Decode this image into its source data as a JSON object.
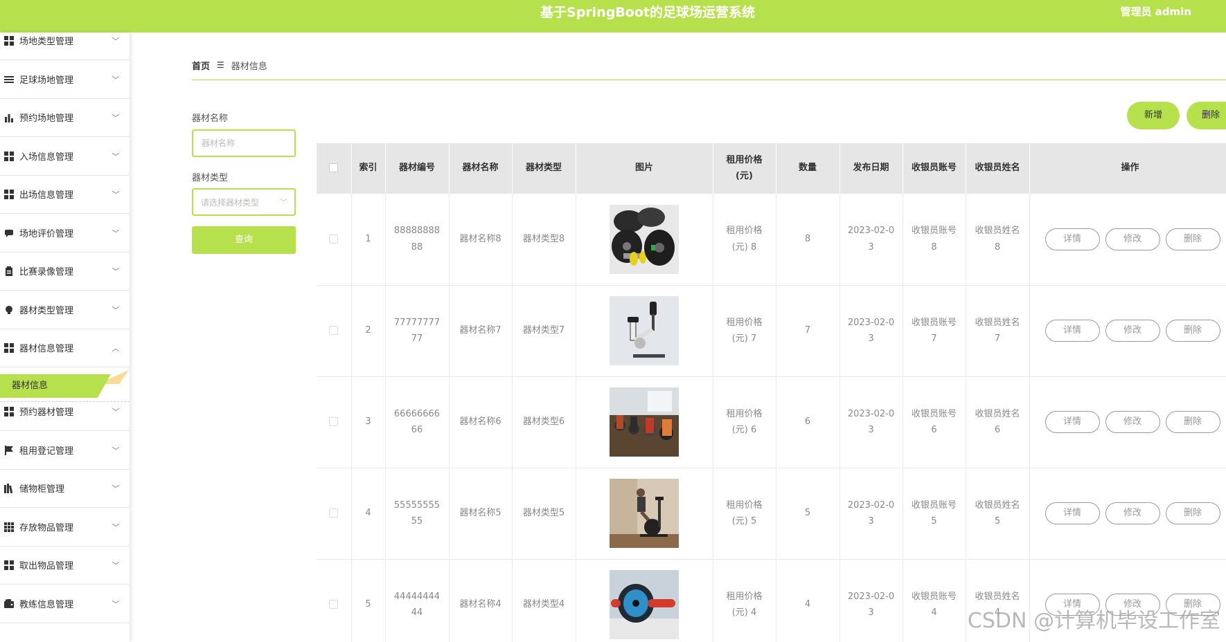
{
  "header": {
    "title": "基于SpringBoot的足球场运营系统",
    "user": "管理员 admin"
  },
  "sidebar": {
    "items": [
      {
        "label": "场地类型管理",
        "icon": "grid-icon"
      },
      {
        "label": "足球场地管理",
        "icon": "list-icon"
      },
      {
        "label": "预约场地管理",
        "icon": "bar-chart-icon"
      },
      {
        "label": "入场信息管理",
        "icon": "grid-icon"
      },
      {
        "label": "出场信息管理",
        "icon": "grid-icon"
      },
      {
        "label": "场地评价管理",
        "icon": "comment-icon"
      },
      {
        "label": "比赛录像管理",
        "icon": "clipboard-icon"
      },
      {
        "label": "器材类型管理",
        "icon": "bulb-icon"
      },
      {
        "label": "器材信息管理",
        "icon": "grid-icon",
        "expanded": true
      },
      {
        "label": "预约器材管理",
        "icon": "grid-icon"
      },
      {
        "label": "租用登记管理",
        "icon": "flag-icon"
      },
      {
        "label": "储物柜管理",
        "icon": "library-icon"
      },
      {
        "label": "存放物品管理",
        "icon": "apps-icon"
      },
      {
        "label": "取出物品管理",
        "icon": "grid-icon"
      },
      {
        "label": "教练信息管理",
        "icon": "wallet-icon"
      }
    ],
    "active_sub": "器材信息"
  },
  "breadcrumb": {
    "home": "首页",
    "current": "器材信息"
  },
  "search": {
    "name_label": "器材名称",
    "name_placeholder": "器材名称",
    "type_label": "器材类型",
    "type_placeholder": "请选择器材类型",
    "query_button": "查询"
  },
  "actions": {
    "add": "新增",
    "delete": "删除"
  },
  "table": {
    "headers": {
      "index": "索引",
      "code": "器材编号",
      "name": "器材名称",
      "type": "器材类型",
      "image": "图片",
      "price_1": "租用价格",
      "price_2": "(元)",
      "qty": "数量",
      "date": "发布日期",
      "cashier_account": "收银员账号",
      "cashier_name": "收银员姓名",
      "ops": "操作"
    },
    "rows": [
      {
        "index": "1",
        "code_1": "88888888",
        "code_2": "88",
        "name": "器材名称8",
        "type": "器材类型8",
        "price_1": "租用价格",
        "price_2": "(元) 8",
        "qty": "8",
        "date_1": "2023-02-0",
        "date_2": "3",
        "acct_1": "收银员账号",
        "acct_2": "8",
        "cname_1": "收银员姓名",
        "cname_2": "8",
        "image": "dumbbell-plates"
      },
      {
        "index": "2",
        "code_1": "77777777",
        "code_2": "77",
        "name": "器材名称7",
        "type": "器材类型7",
        "price_1": "租用价格",
        "price_2": "(元) 7",
        "qty": "7",
        "date_1": "2023-02-0",
        "date_2": "3",
        "acct_1": "收银员账号",
        "acct_2": "7",
        "cname_1": "收银员姓名",
        "cname_2": "7",
        "image": "exercise-bike"
      },
      {
        "index": "3",
        "code_1": "66666666",
        "code_2": "66",
        "name": "器材名称6",
        "type": "器材类型6",
        "price_1": "租用价格",
        "price_2": "(元) 6",
        "qty": "6",
        "date_1": "2023-02-0",
        "date_2": "3",
        "acct_1": "收银员账号",
        "acct_2": "6",
        "cname_1": "收银员姓名",
        "cname_2": "6",
        "image": "spin-class"
      },
      {
        "index": "4",
        "code_1": "55555555",
        "code_2": "55",
        "name": "器材名称5",
        "type": "器材类型5",
        "price_1": "租用价格",
        "price_2": "(元) 5",
        "qty": "5",
        "date_1": "2023-02-0",
        "date_2": "3",
        "acct_1": "收银员账号",
        "acct_2": "5",
        "cname_1": "收银员姓名",
        "cname_2": "5",
        "image": "spin-bike-rider"
      },
      {
        "index": "5",
        "code_1": "44444444",
        "code_2": "44",
        "name": "器材名称4",
        "type": "器材类型4",
        "price_1": "租用价格",
        "price_2": "(元) 4",
        "qty": "4",
        "date_1": "2023-02-0",
        "date_2": "3",
        "acct_1": "收银员账号",
        "acct_2": "4",
        "cname_1": "收银员姓名",
        "cname_2": "4",
        "image": "ab-roller"
      }
    ],
    "op_labels": {
      "detail": "详情",
      "edit": "修改",
      "delete": "删除"
    }
  },
  "watermark": "CSDN @计算机毕设工作室",
  "colors": {
    "accent": "#b7e04d",
    "header_bg": "#e6e6e6"
  }
}
